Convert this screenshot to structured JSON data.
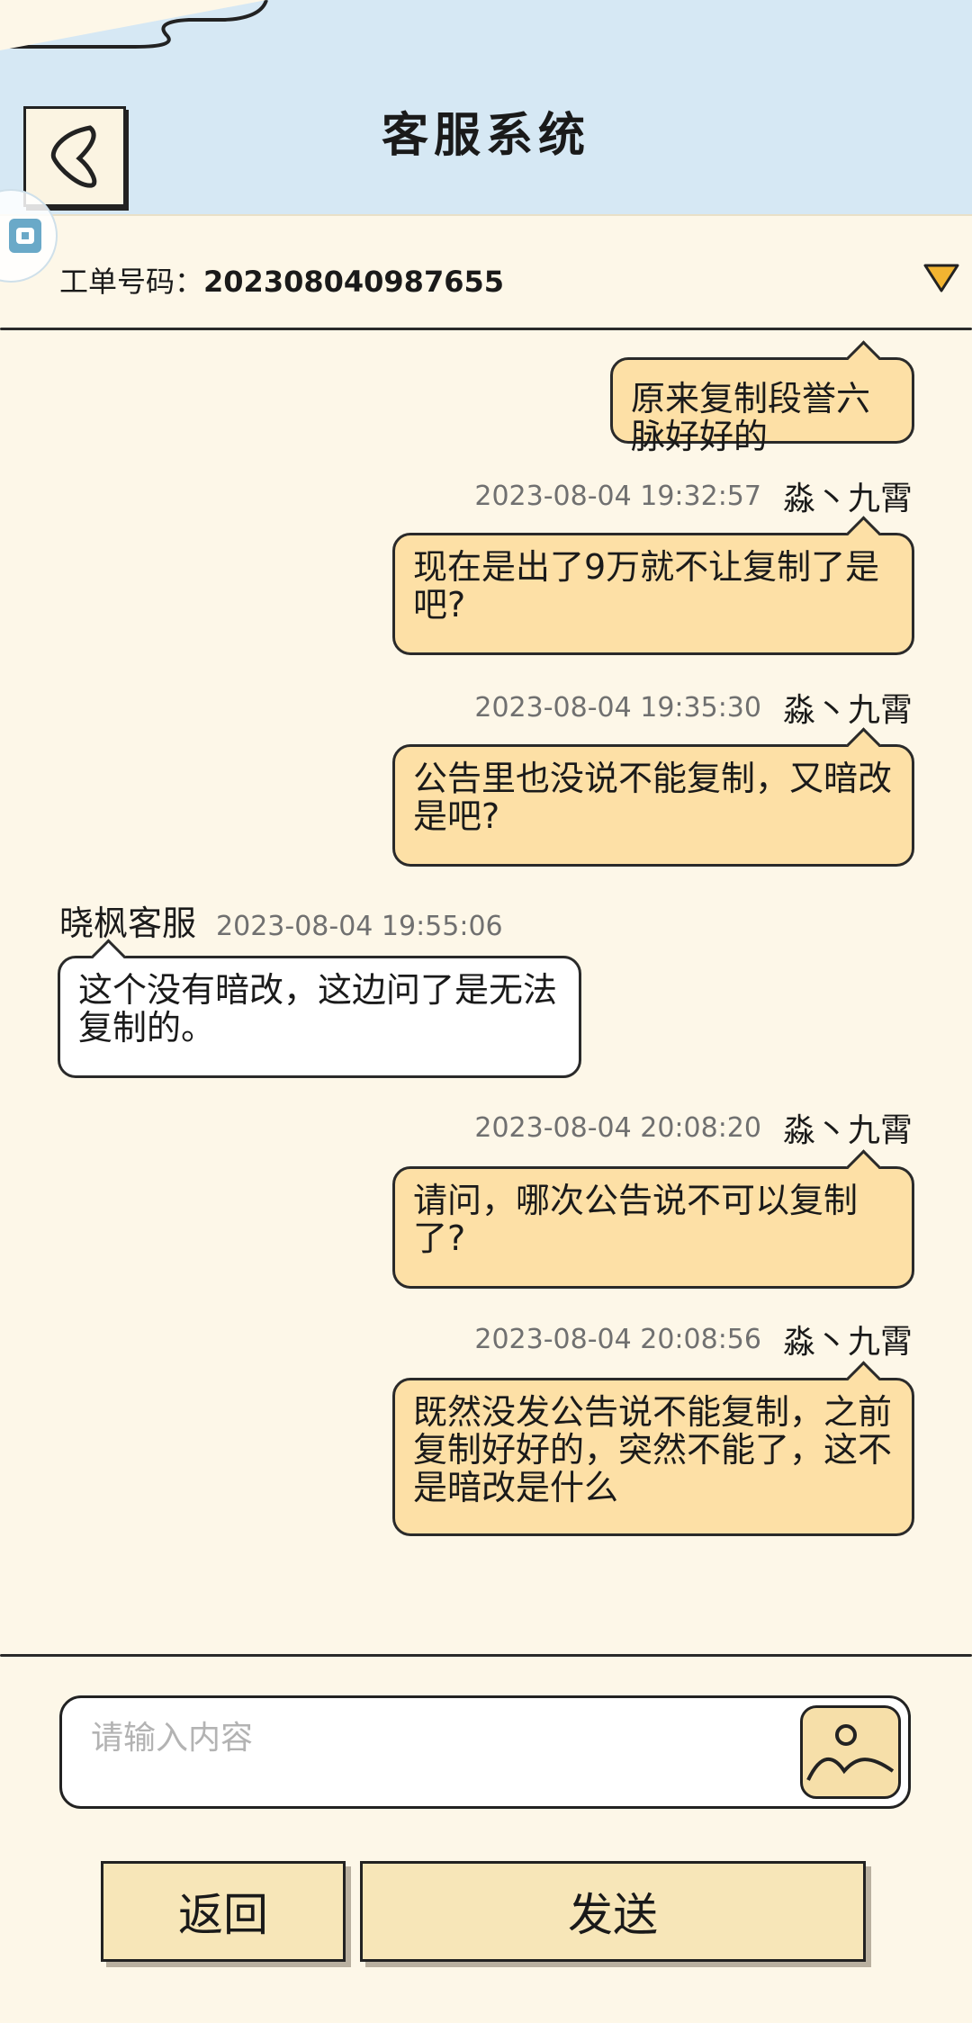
{
  "header": {
    "title": "客服系统"
  },
  "ticket": {
    "label": "工单号码：",
    "number": "202308040987655"
  },
  "messages": [
    {
      "from": "me",
      "time": "",
      "name": "",
      "text": "原来复制段誉六脉好好的"
    },
    {
      "from": "me",
      "time": "2023-08-04 19:32:57",
      "name": "淼丶九霄",
      "text": "现在是出了9万就不让复制了是吧?"
    },
    {
      "from": "me",
      "time": "2023-08-04 19:35:30",
      "name": "淼丶九霄",
      "text": "公告里也没说不能复制，又暗改是吧?"
    },
    {
      "from": "cs",
      "time": "2023-08-04 19:55:06",
      "name": "晓枫客服",
      "text": "这个没有暗改，这边问了是无法复制的。"
    },
    {
      "from": "me",
      "time": "2023-08-04 20:08:20",
      "name": "淼丶九霄",
      "text": "请问，哪次公告说不可以复制了?"
    },
    {
      "from": "me",
      "time": "2023-08-04 20:08:56",
      "name": "淼丶九霄",
      "text": "既然没发公告说不能复制，之前复制好好的，突然不能了，这不是暗改是什么"
    }
  ],
  "input": {
    "placeholder": "请输入内容"
  },
  "buttons": {
    "back": "返回",
    "send": "发送"
  },
  "icons": {
    "back": "chevron-left-icon",
    "dropdown": "triangle-down-icon",
    "image": "image-icon"
  },
  "colors": {
    "header_bg": "#d6e8f4",
    "page_bg": "#fdf7e8",
    "my_bubble": "#fde0a6",
    "cs_bubble": "#ffffff",
    "button_bg": "#f7e6b8",
    "dropdown": "#f2b431"
  }
}
